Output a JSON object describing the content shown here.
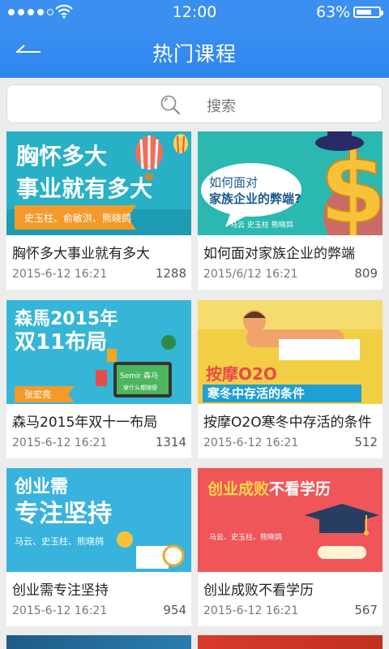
{
  "status_bar": {
    "time": "12:00",
    "battery": "63%"
  },
  "navbar": {
    "title": "热门课程"
  },
  "search": {
    "placeholder": "搜索"
  },
  "courses": [
    {
      "title": "胸怀多大事业就有多大",
      "date": "2015-6-12 16:21",
      "views": "1288",
      "banner": {
        "line1": "胸怀多大",
        "line2": "事业就有多大",
        "tag": "史玉柱、俞敏洪、熊晓鸽"
      }
    },
    {
      "title": "如何面对家族企业的弊端",
      "date": "2015/6/12 16:21",
      "views": "809",
      "banner": {
        "line1": "如何面对",
        "line2": "家族企业的弊端?",
        "tag": "马云  史玉柱  熊晓鸽"
      }
    },
    {
      "title": "森马2015年双十一布局",
      "date": "2015-6-12 16:21",
      "views": "1314",
      "banner": {
        "line1": "森馬2015年",
        "line2": "双11布局",
        "tag": "张宏亮",
        "screen": "Semir 森马",
        "screen2": "穿什么都随便"
      }
    },
    {
      "title": "按摩O2O寒冬中存活的条件",
      "date": "2015-6-12 16:21",
      "views": "512",
      "banner": {
        "line1": "按摩O2O",
        "line2": "寒冬中存活的条件"
      }
    },
    {
      "title": "创业需专注坚持",
      "date": "2015-6-12 16:21",
      "views": "954",
      "banner": {
        "line1": "创业需",
        "line2": "专注坚持",
        "tag": "马云、史玉柱、熊晓鸽"
      }
    },
    {
      "title": "创业成败不看学历",
      "date": "2015-6-12 16:21",
      "views": "567",
      "banner": {
        "line1a": "创业成败",
        "line1b": "不看学历",
        "tag": "马云、史玉柱、熊晓鸽"
      }
    }
  ],
  "colors": {
    "primary": "#3a8ff0",
    "accent_orange": "#f39a2b",
    "banner_red": "#f0555a"
  }
}
